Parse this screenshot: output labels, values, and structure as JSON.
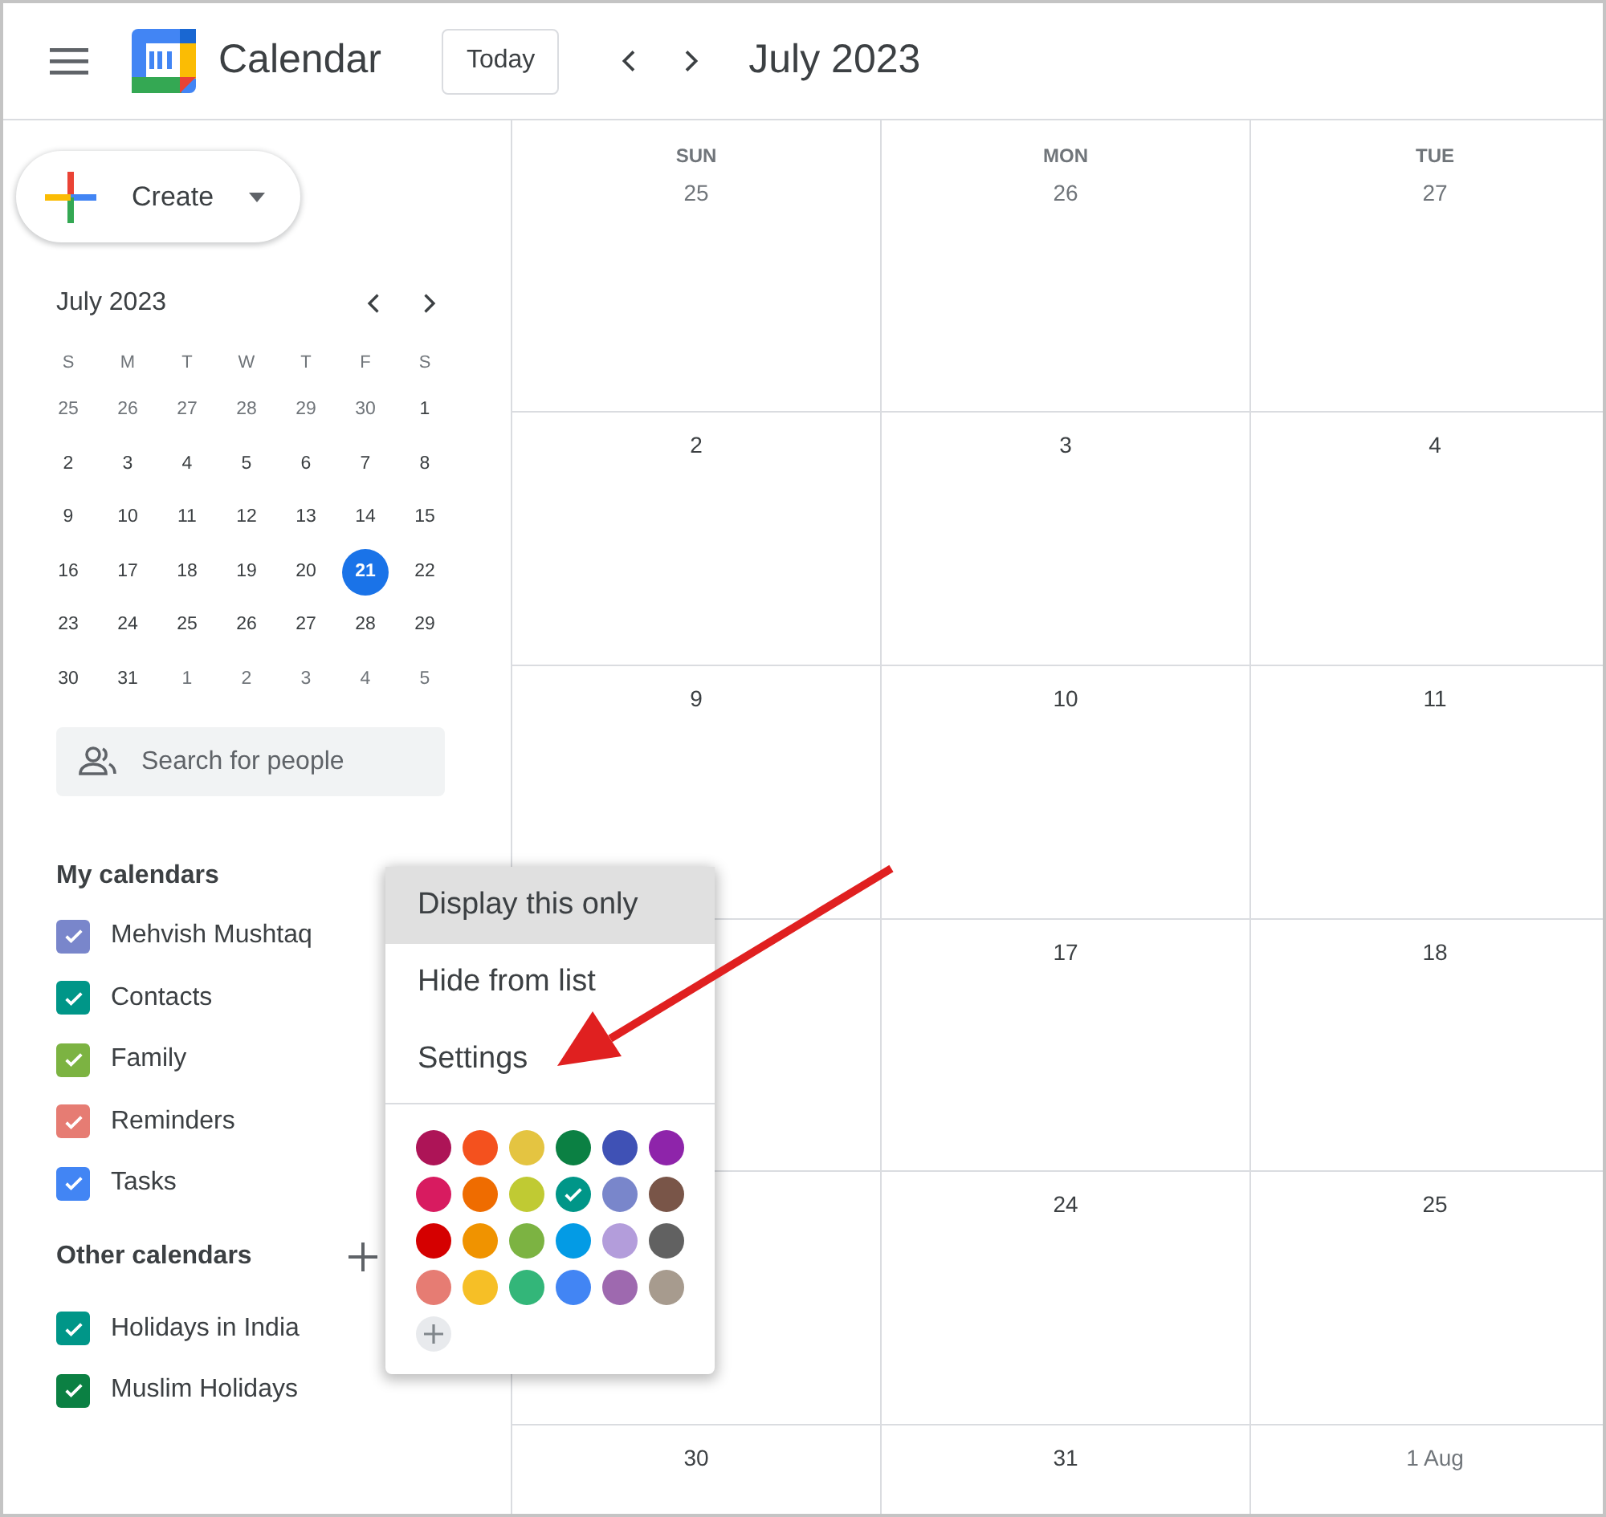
{
  "header": {
    "app_name": "Calendar",
    "today_button": "Today",
    "period": "July 2023"
  },
  "sidebar": {
    "create_button": "Create",
    "mini_calendar": {
      "title": "July 2023",
      "weekdays": [
        "S",
        "M",
        "T",
        "W",
        "T",
        "F",
        "S"
      ],
      "weeks": [
        [
          {
            "label": "25",
            "in_month": false,
            "selected": false
          },
          {
            "label": "26",
            "in_month": false,
            "selected": false
          },
          {
            "label": "27",
            "in_month": false,
            "selected": false
          },
          {
            "label": "28",
            "in_month": false,
            "selected": false
          },
          {
            "label": "29",
            "in_month": false,
            "selected": false
          },
          {
            "label": "30",
            "in_month": false,
            "selected": false
          },
          {
            "label": "1",
            "in_month": true,
            "selected": false
          }
        ],
        [
          {
            "label": "2",
            "in_month": true,
            "selected": false
          },
          {
            "label": "3",
            "in_month": true,
            "selected": false
          },
          {
            "label": "4",
            "in_month": true,
            "selected": false
          },
          {
            "label": "5",
            "in_month": true,
            "selected": false
          },
          {
            "label": "6",
            "in_month": true,
            "selected": false
          },
          {
            "label": "7",
            "in_month": true,
            "selected": false
          },
          {
            "label": "8",
            "in_month": true,
            "selected": false
          }
        ],
        [
          {
            "label": "9",
            "in_month": true,
            "selected": false
          },
          {
            "label": "10",
            "in_month": true,
            "selected": false
          },
          {
            "label": "11",
            "in_month": true,
            "selected": false
          },
          {
            "label": "12",
            "in_month": true,
            "selected": false
          },
          {
            "label": "13",
            "in_month": true,
            "selected": false
          },
          {
            "label": "14",
            "in_month": true,
            "selected": false
          },
          {
            "label": "15",
            "in_month": true,
            "selected": false
          }
        ],
        [
          {
            "label": "16",
            "in_month": true,
            "selected": false
          },
          {
            "label": "17",
            "in_month": true,
            "selected": false
          },
          {
            "label": "18",
            "in_month": true,
            "selected": false
          },
          {
            "label": "19",
            "in_month": true,
            "selected": false
          },
          {
            "label": "20",
            "in_month": true,
            "selected": false
          },
          {
            "label": "21",
            "in_month": true,
            "selected": true
          },
          {
            "label": "22",
            "in_month": true,
            "selected": false
          }
        ],
        [
          {
            "label": "23",
            "in_month": true,
            "selected": false
          },
          {
            "label": "24",
            "in_month": true,
            "selected": false
          },
          {
            "label": "25",
            "in_month": true,
            "selected": false
          },
          {
            "label": "26",
            "in_month": true,
            "selected": false
          },
          {
            "label": "27",
            "in_month": true,
            "selected": false
          },
          {
            "label": "28",
            "in_month": true,
            "selected": false
          },
          {
            "label": "29",
            "in_month": true,
            "selected": false
          }
        ],
        [
          {
            "label": "30",
            "in_month": true,
            "selected": false
          },
          {
            "label": "31",
            "in_month": true,
            "selected": false
          },
          {
            "label": "1",
            "in_month": false,
            "selected": false
          },
          {
            "label": "2",
            "in_month": false,
            "selected": false
          },
          {
            "label": "3",
            "in_month": false,
            "selected": false
          },
          {
            "label": "4",
            "in_month": false,
            "selected": false
          },
          {
            "label": "5",
            "in_month": false,
            "selected": false
          }
        ]
      ]
    },
    "search": {
      "placeholder": "Search for people"
    },
    "my_calendars": {
      "title": "My calendars",
      "items": [
        {
          "label": "Mehvish Mushtaq",
          "checked": true,
          "color": "#7986cb"
        },
        {
          "label": "Contacts",
          "checked": true,
          "color": "#009688"
        },
        {
          "label": "Family",
          "checked": true,
          "color": "#7cb342"
        },
        {
          "label": "Reminders",
          "checked": true,
          "color": "#e67c73"
        },
        {
          "label": "Tasks",
          "checked": true,
          "color": "#4285f4"
        }
      ]
    },
    "other_calendars": {
      "title": "Other calendars",
      "items": [
        {
          "label": "Holidays in India",
          "checked": true,
          "color": "#009688"
        },
        {
          "label": "Muslim Holidays",
          "checked": true,
          "color": "#0b8043"
        }
      ]
    }
  },
  "month_grid": {
    "weekdays": [
      "SUN",
      "MON",
      "TUE"
    ],
    "rows": [
      [
        {
          "date": "25",
          "in_month": false
        },
        {
          "date": "26",
          "in_month": false
        },
        {
          "date": "27",
          "in_month": false
        }
      ],
      [
        {
          "date": "2",
          "in_month": true
        },
        {
          "date": "3",
          "in_month": true
        },
        {
          "date": "4",
          "in_month": true
        }
      ],
      [
        {
          "date": "9",
          "in_month": true
        },
        {
          "date": "10",
          "in_month": true
        },
        {
          "date": "11",
          "in_month": true
        }
      ],
      [
        {},
        {
          "date": "17",
          "in_month": true
        },
        {
          "date": "18",
          "in_month": true
        }
      ],
      [
        {},
        {
          "date": "24",
          "in_month": true
        },
        {
          "date": "25",
          "in_month": true
        }
      ],
      [
        {
          "date": "30",
          "in_month": true
        },
        {
          "date": "31",
          "in_month": true
        },
        {
          "date": "1 Aug",
          "in_month": false
        }
      ]
    ]
  },
  "context_menu": {
    "items": [
      {
        "label": "Display this only",
        "selected": true
      },
      {
        "label": "Hide from list",
        "selected": false
      },
      {
        "label": "Settings",
        "selected": false
      }
    ],
    "colors": [
      {
        "color": "#ad1457",
        "selected": false
      },
      {
        "color": "#f4511e",
        "selected": false
      },
      {
        "color": "#e4c441",
        "selected": false
      },
      {
        "color": "#0b8043",
        "selected": false
      },
      {
        "color": "#3f51b5",
        "selected": false
      },
      {
        "color": "#8e24aa",
        "selected": false
      },
      {
        "color": "#d81b60",
        "selected": false
      },
      {
        "color": "#ef6c00",
        "selected": false
      },
      {
        "color": "#c0ca33",
        "selected": false
      },
      {
        "color": "#009688",
        "selected": true
      },
      {
        "color": "#7986cb",
        "selected": false
      },
      {
        "color": "#795548",
        "selected": false
      },
      {
        "color": "#d50000",
        "selected": false
      },
      {
        "color": "#f09300",
        "selected": false
      },
      {
        "color": "#7cb342",
        "selected": false
      },
      {
        "color": "#039be5",
        "selected": false
      },
      {
        "color": "#b39ddb",
        "selected": false
      },
      {
        "color": "#616161",
        "selected": false
      },
      {
        "color": "#e67c73",
        "selected": false
      },
      {
        "color": "#f6bf26",
        "selected": false
      },
      {
        "color": "#33b679",
        "selected": false
      },
      {
        "color": "#4285f4",
        "selected": false
      },
      {
        "color": "#9e69af",
        "selected": false
      },
      {
        "color": "#a79b8e",
        "selected": false
      }
    ]
  }
}
